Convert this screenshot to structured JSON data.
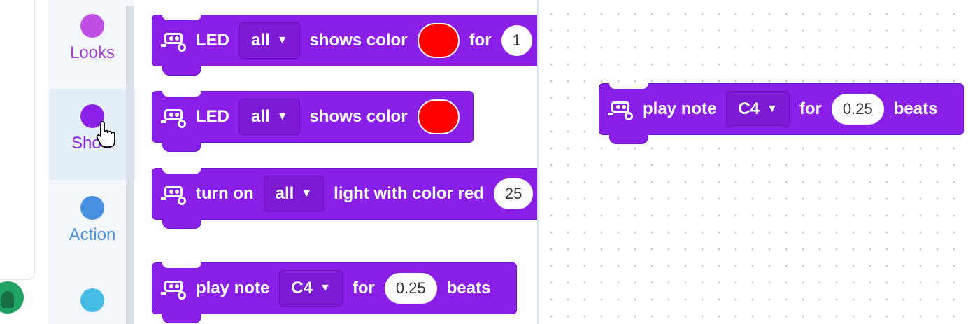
{
  "categories": [
    {
      "label": "Looks",
      "color": "#c04ee6",
      "text_color": "#a040d8"
    },
    {
      "label": "Show",
      "color": "#8a1fe8",
      "text_color": "#8a1fe8"
    },
    {
      "label": "Action",
      "color": "#4a90e2",
      "text_color": "#4a90e2"
    },
    {
      "label": "",
      "color": "#45bde6",
      "text_color": "#45bde6"
    }
  ],
  "palette_blocks": {
    "led_shows_color_for": {
      "led": "LED",
      "target": "all",
      "verb": "shows color",
      "swatch": "#ff0000",
      "for": "for",
      "value": "1"
    },
    "led_shows_color": {
      "led": "LED",
      "target": "all",
      "verb": "shows color",
      "swatch": "#ff0000"
    },
    "turn_on_light": {
      "prefix": "turn on",
      "target": "all",
      "suffix": "light with color red",
      "value": "25"
    },
    "play_note": {
      "prefix": "play note",
      "note": "C4",
      "for": "for",
      "beats_value": "0.25",
      "beats": "beats"
    }
  },
  "workspace_blocks": {
    "play_note": {
      "prefix": "play note",
      "note": "C4",
      "for": "for",
      "beats_value": "0.25",
      "beats": "beats"
    }
  },
  "colors": {
    "block": "#8a1fe8",
    "accent": "#8a1fe8"
  }
}
